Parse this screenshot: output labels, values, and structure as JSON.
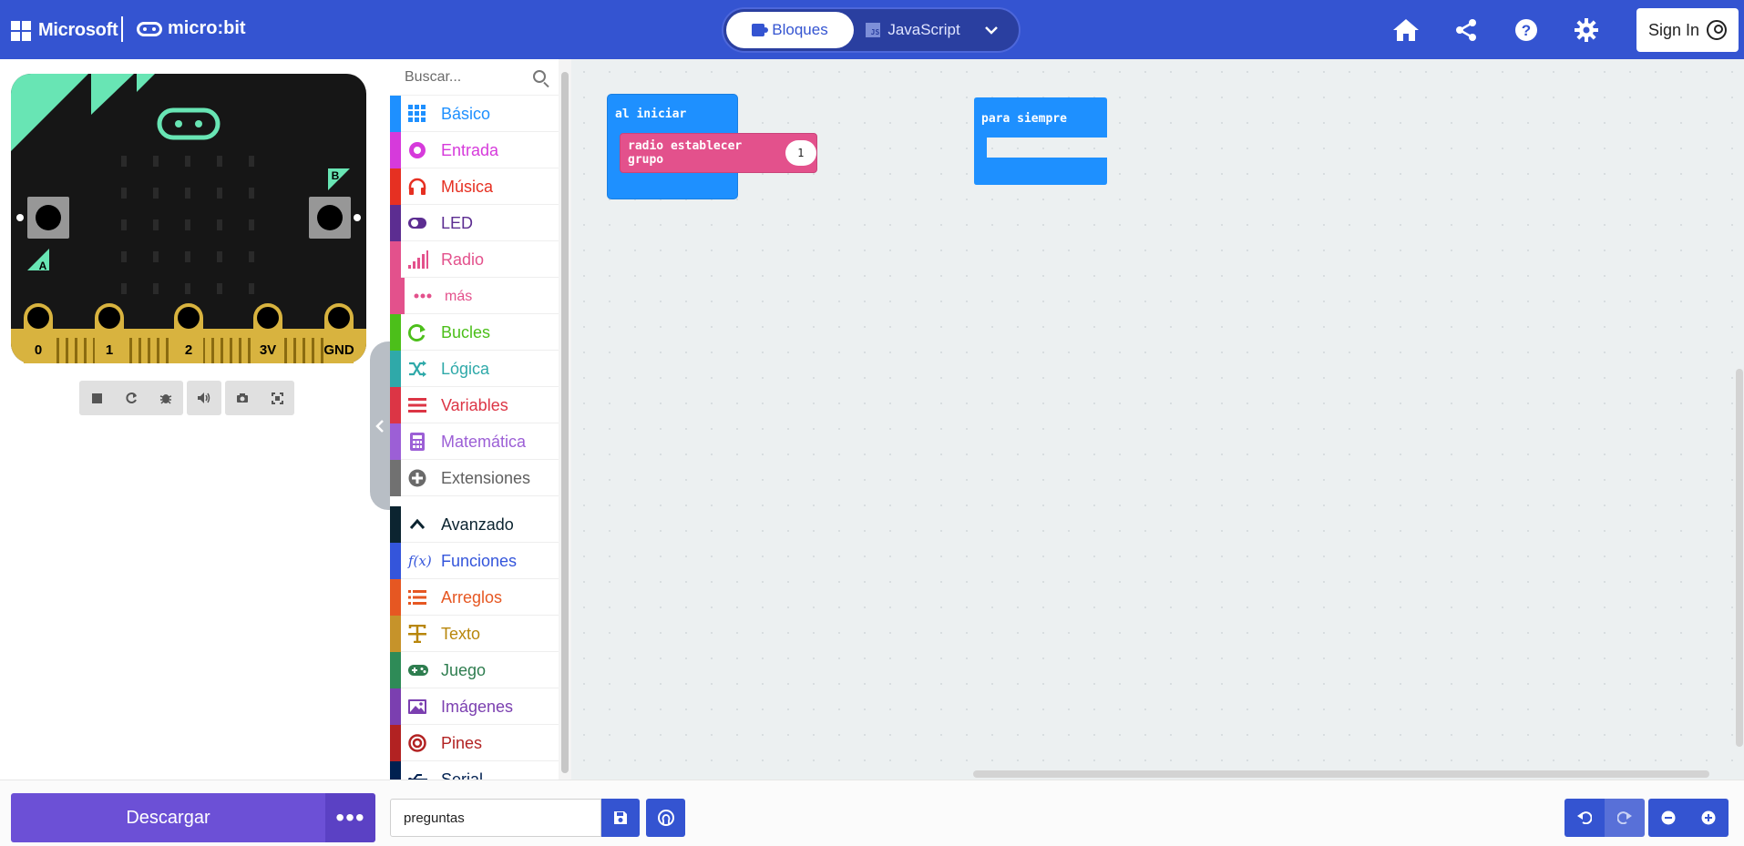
{
  "header": {
    "ms_label": "Microsoft",
    "brand_label": "micro:bit",
    "mode_blocks": "Bloques",
    "mode_js": "JavaScript",
    "icons": [
      "home-icon",
      "share-icon",
      "help-icon",
      "settings-icon"
    ],
    "signin_label": "Sign In"
  },
  "simulator": {
    "pins": [
      "0",
      "1",
      "2",
      "3V",
      "GND"
    ],
    "button_a": "A",
    "button_b": "B",
    "controls": [
      "stop-icon",
      "restart-icon",
      "debug-icon",
      "mute-icon",
      "screenshot-icon",
      "fullscreen-icon"
    ]
  },
  "toolbox": {
    "search_placeholder": "Buscar...",
    "categories": [
      {
        "label": "Básico",
        "color": "#1e90ff",
        "icon": "grid-icon"
      },
      {
        "label": "Entrada",
        "color": "#d400d4",
        "icon": "input-icon"
      },
      {
        "label": "Música",
        "color": "#e63022",
        "icon": "headphones-icon"
      },
      {
        "label": "LED",
        "color": "#5c2d91",
        "icon": "toggle-icon"
      },
      {
        "label": "Radio",
        "color": "#e3008c",
        "icon": "signal-icon"
      },
      {
        "label": "más",
        "color": "#e3008c",
        "icon": "more-icon"
      },
      {
        "label": "Bucles",
        "color": "#00aa00",
        "icon": "loop-icon"
      },
      {
        "label": "Lógica",
        "color": "#00a4a6",
        "icon": "shuffle-icon"
      },
      {
        "label": "Variables",
        "color": "#dc143c",
        "icon": "list-icon"
      },
      {
        "label": "Matemática",
        "color": "#9400d3",
        "icon": "calculator-icon"
      },
      {
        "label": "Extensiones",
        "color": "#717171",
        "icon": "plus-circle-icon"
      },
      {
        "label": "Avanzado",
        "color": "#0c1e1e",
        "icon": "chevron-up-icon"
      },
      {
        "label": "Funciones",
        "color": "#3455db",
        "icon": "function-icon"
      },
      {
        "label": "Arreglos",
        "color": "#e65722",
        "icon": "array-icon"
      },
      {
        "label": "Texto",
        "color": "#b8860b",
        "icon": "text-icon"
      },
      {
        "label": "Juego",
        "color": "#007a4b",
        "icon": "gamepad-icon"
      },
      {
        "label": "Imágenes",
        "color": "#7600a8",
        "icon": "image-icon"
      },
      {
        "label": "Pines",
        "color": "#b22222",
        "icon": "target-icon"
      },
      {
        "label": "Serial",
        "color": "#002050",
        "icon": "usb-icon"
      }
    ]
  },
  "workspace": {
    "on_start_label": "al iniciar",
    "radio_block_label": "radio establecer grupo",
    "radio_group_value": "1",
    "forever_label": "para siempre"
  },
  "bottom": {
    "download_label": "Descargar",
    "more_label": "•••",
    "project_name": "preguntas"
  },
  "colors": {
    "header_bg": "#3454d1",
    "download_bg": "#6c50d6",
    "block_blue": "#1e90ff",
    "block_radio": "#e3518c"
  }
}
